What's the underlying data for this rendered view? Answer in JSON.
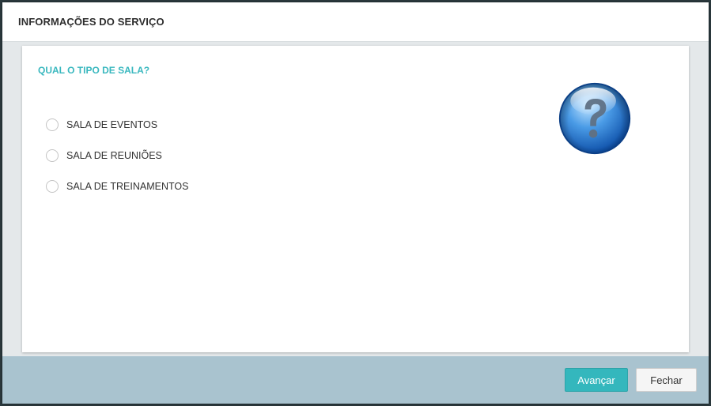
{
  "modal": {
    "title": "INFORMAÇÕES DO SERVIÇO",
    "question": "QUAL O TIPO DE SALA?",
    "options": [
      {
        "label": "SALA DE EVENTOS",
        "selected": false
      },
      {
        "label": "SALA DE REUNIÕES",
        "selected": false
      },
      {
        "label": "SALA DE TREINAMENTOS",
        "selected": false
      }
    ],
    "icon": "question-mark-icon"
  },
  "footer": {
    "next_label": "Avançar",
    "close_label": "Fechar"
  },
  "colors": {
    "accent": "#34b7bd",
    "question_text": "#3ab8bf",
    "footer_bg": "#a9c3cf",
    "header_bg": "#ffffff"
  }
}
